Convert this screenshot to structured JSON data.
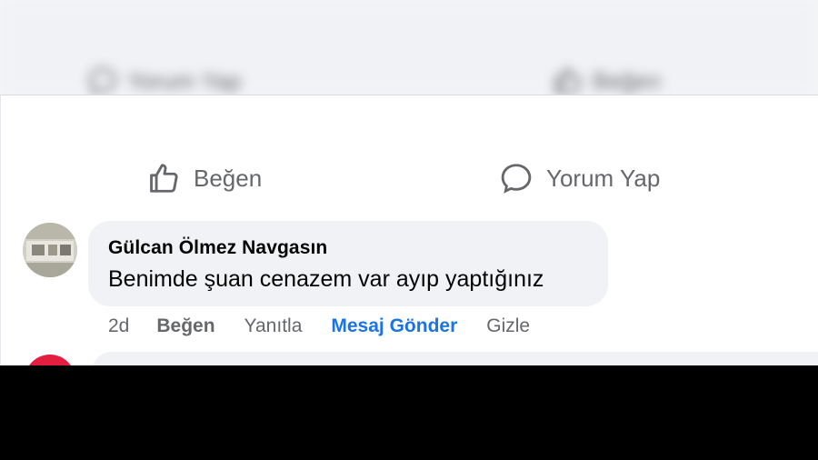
{
  "background": {
    "comment_label": "Yorum Yap",
    "like_label": "Beğen"
  },
  "actions": {
    "like_label": "Beğen",
    "comment_label": "Yorum Yap"
  },
  "comment": {
    "author": "Gülcan Ölmez Navgasın",
    "text": "Benimde şuan cenazem var ayıp yaptığınız",
    "time": "2d",
    "like_action": "Beğen",
    "reply_action": "Yanıtla",
    "message_action": "Mesaj Gönder",
    "hide_action": "Gizle"
  },
  "colors": {
    "link_blue": "#1b74e4",
    "secondary_text": "#65676b",
    "bubble_bg": "#f0f2f5"
  }
}
